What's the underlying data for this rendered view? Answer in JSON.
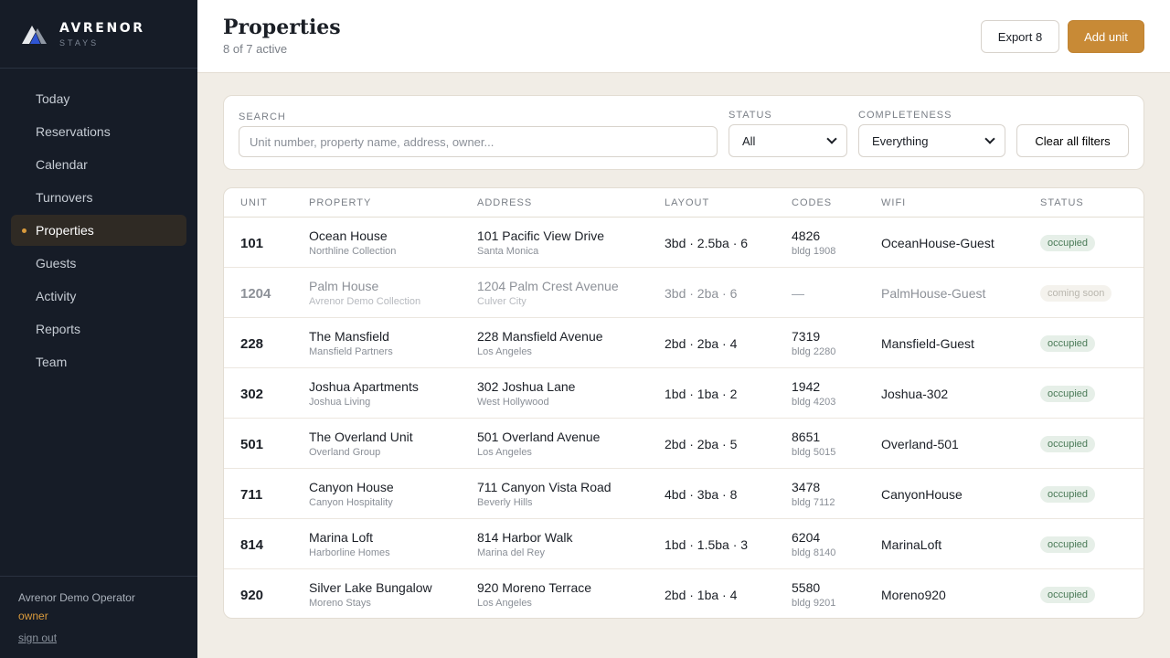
{
  "brand": {
    "name": "AVRENOR",
    "sub": "STAYS"
  },
  "nav": [
    {
      "label": "Today"
    },
    {
      "label": "Reservations"
    },
    {
      "label": "Calendar"
    },
    {
      "label": "Turnovers"
    },
    {
      "label": "Properties",
      "active": true
    },
    {
      "label": "Guests"
    },
    {
      "label": "Activity"
    },
    {
      "label": "Reports"
    },
    {
      "label": "Team"
    }
  ],
  "account": {
    "operator": "Avrenor Demo Operator",
    "role": "owner",
    "signout": "sign out"
  },
  "header": {
    "title": "Properties",
    "subtitle": "8 of 7 active",
    "export_label": "Export 8",
    "add_label": "Add unit"
  },
  "filters": {
    "search_label": "SEARCH",
    "search_placeholder": "Unit number, property name, address, owner...",
    "status_label": "STATUS",
    "status_value": "All",
    "completeness_label": "COMPLETENESS",
    "completeness_value": "Everything",
    "clear_label": "Clear all filters"
  },
  "table": {
    "headers": [
      "UNIT",
      "PROPERTY",
      "ADDRESS",
      "LAYOUT",
      "CODES",
      "WIFI",
      "STATUS"
    ],
    "rows": [
      {
        "unit": "101",
        "property": "Ocean House",
        "collection": "Northline Collection",
        "address": "101 Pacific View Drive",
        "city": "Santa Monica",
        "layout": "3bd · 2.5ba · 6",
        "code": "4826",
        "bldg": "bldg 1908",
        "wifi": "OceanHouse-Guest",
        "status": "occupied"
      },
      {
        "unit": "1204",
        "property": "Palm House",
        "collection": "Avrenor Demo Collection",
        "address": "1204 Palm Crest Avenue",
        "city": "Culver City",
        "layout": "3bd · 2ba · 6",
        "code": "—",
        "bldg": "",
        "wifi": "PalmHouse-Guest",
        "status": "coming soon",
        "muted": true
      },
      {
        "unit": "228",
        "property": "The Mansfield",
        "collection": "Mansfield Partners",
        "address": "228 Mansfield Avenue",
        "city": "Los Angeles",
        "layout": "2bd · 2ba · 4",
        "code": "7319",
        "bldg": "bldg 2280",
        "wifi": "Mansfield-Guest",
        "status": "occupied"
      },
      {
        "unit": "302",
        "property": "Joshua Apartments",
        "collection": "Joshua Living",
        "address": "302 Joshua Lane",
        "city": "West Hollywood",
        "layout": "1bd · 1ba · 2",
        "code": "1942",
        "bldg": "bldg 4203",
        "wifi": "Joshua-302",
        "status": "occupied"
      },
      {
        "unit": "501",
        "property": "The Overland Unit",
        "collection": "Overland Group",
        "address": "501 Overland Avenue",
        "city": "Los Angeles",
        "layout": "2bd · 2ba · 5",
        "code": "8651",
        "bldg": "bldg 5015",
        "wifi": "Overland-501",
        "status": "occupied"
      },
      {
        "unit": "711",
        "property": "Canyon House",
        "collection": "Canyon Hospitality",
        "address": "711 Canyon Vista Road",
        "city": "Beverly Hills",
        "layout": "4bd · 3ba · 8",
        "code": "3478",
        "bldg": "bldg 7112",
        "wifi": "CanyonHouse",
        "status": "occupied"
      },
      {
        "unit": "814",
        "property": "Marina Loft",
        "collection": "Harborline Homes",
        "address": "814 Harbor Walk",
        "city": "Marina del Rey",
        "layout": "1bd · 1.5ba · 3",
        "code": "6204",
        "bldg": "bldg 8140",
        "wifi": "MarinaLoft",
        "status": "occupied"
      },
      {
        "unit": "920",
        "property": "Silver Lake Bungalow",
        "collection": "Moreno Stays",
        "address": "920 Moreno Terrace",
        "city": "Los Angeles",
        "layout": "2bd · 1ba · 4",
        "code": "5580",
        "bldg": "bldg 9201",
        "wifi": "Moreno920",
        "status": "occupied"
      }
    ]
  },
  "colors": {
    "sidebar": "#161c27",
    "accent": "#c88a36",
    "occupied_badge": "#e6efe8",
    "page_bg": "#f1ede6"
  }
}
